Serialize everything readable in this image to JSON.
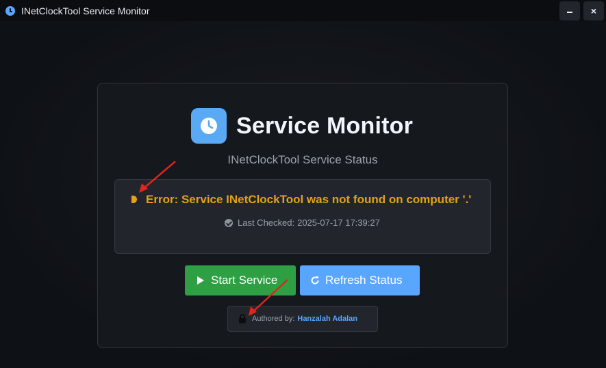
{
  "window": {
    "title": "INetClockTool Service Monitor",
    "minimize_icon": "minimize-icon",
    "close_label": "×"
  },
  "header": {
    "logo_icon": "clock-icon",
    "title": "Service Monitor",
    "subtitle": "INetClockTool Service Status"
  },
  "status": {
    "indicator_color": "#e3a21a",
    "message": "Error: Service INetClockTool was not found on computer '.'",
    "last_checked_label": "Last Checked:",
    "last_checked_value": "2025-07-17 17:39:27"
  },
  "actions": {
    "start_label": "Start Service",
    "refresh_label": "Refresh Status"
  },
  "footer": {
    "authored_label": "Authored by:",
    "author_name": "Hanzalah Adalan"
  },
  "colors": {
    "background": "#0e1116",
    "accent": "#58a6ff",
    "success": "#2ea043",
    "warning": "#e3a21a",
    "annotation": "#e0251b"
  }
}
